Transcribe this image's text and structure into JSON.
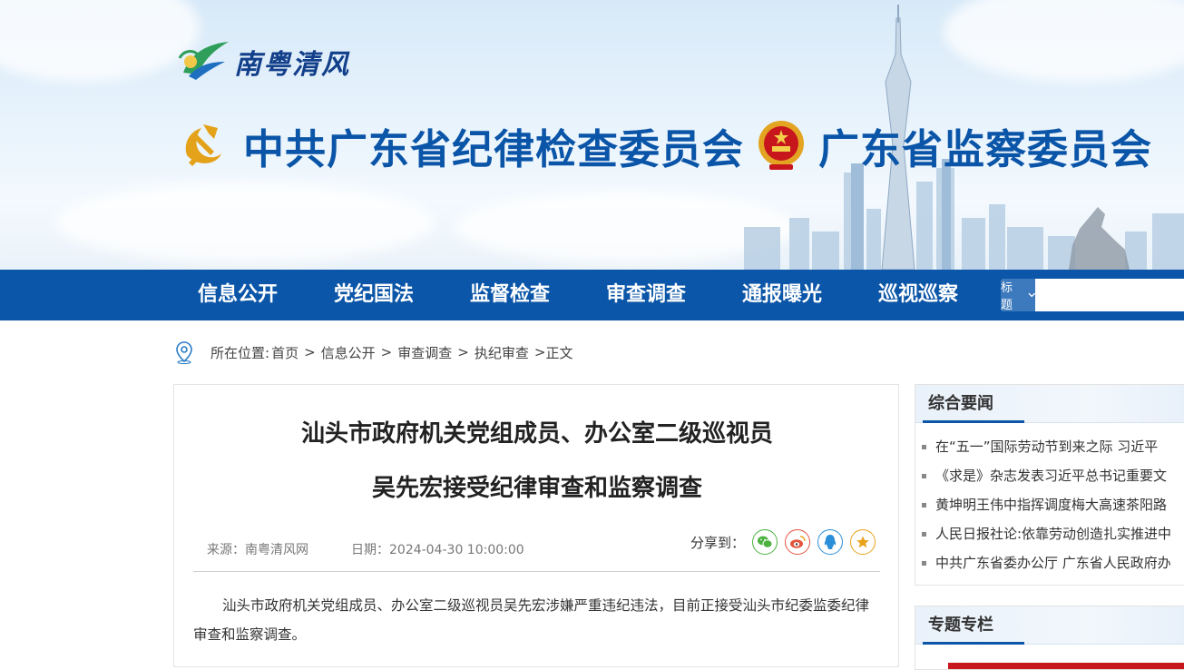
{
  "header": {
    "site_name": "南粤清风",
    "title_left": "中共广东省纪律检查委员会",
    "title_right": "广东省监察委员会"
  },
  "nav": {
    "items": [
      {
        "label": "信息公开"
      },
      {
        "label": "党纪国法"
      },
      {
        "label": "监督检查"
      },
      {
        "label": "审查调查"
      },
      {
        "label": "通报曝光"
      },
      {
        "label": "巡视巡察"
      }
    ],
    "search": {
      "select_value": "标题",
      "placeholder": ""
    }
  },
  "breadcrumb": {
    "label": "所在位置:",
    "items": [
      "首页",
      "信息公开",
      "审查调查",
      "执纪审查"
    ],
    "current": "正文"
  },
  "article": {
    "title_line1": "汕头市政府机关党组成员、办公室二级巡视员",
    "title_line2": "吴先宏接受纪律审查和监察调查",
    "source": "来源：南粤清风网",
    "date": "日期：2024-04-30 10:00:00",
    "share_label": "分享到：",
    "share_buttons": [
      {
        "name": "wechat",
        "color": "#4bb13f"
      },
      {
        "name": "weibo",
        "color": "#e5533d"
      },
      {
        "name": "qq",
        "color": "#2a8ed8"
      },
      {
        "name": "favorite",
        "color": "#e9a21c"
      }
    ],
    "body": "汕头市政府机关党组成员、办公室二级巡视员吴先宏涉嫌严重违纪违法，目前正接受汕头市纪委监委纪律审查和监察调查。"
  },
  "sidebar": {
    "news": {
      "title": "综合要闻",
      "items": [
        "在“五一”国际劳动节到来之际 习近平",
        "《求是》杂志发表习近平总书记重要文",
        "黄坤明王伟中指挥调度梅大高速茶阳路",
        "人民日报社论:依靠劳动创造扎实推进中",
        "中共广东省委办公厅 广东省人民政府办"
      ]
    },
    "special": {
      "title": "专题专栏"
    }
  },
  "colors": {
    "nav_bg": "#0b56a8",
    "title_blue": "#0b55a8",
    "accent_red": "#c8161d"
  }
}
